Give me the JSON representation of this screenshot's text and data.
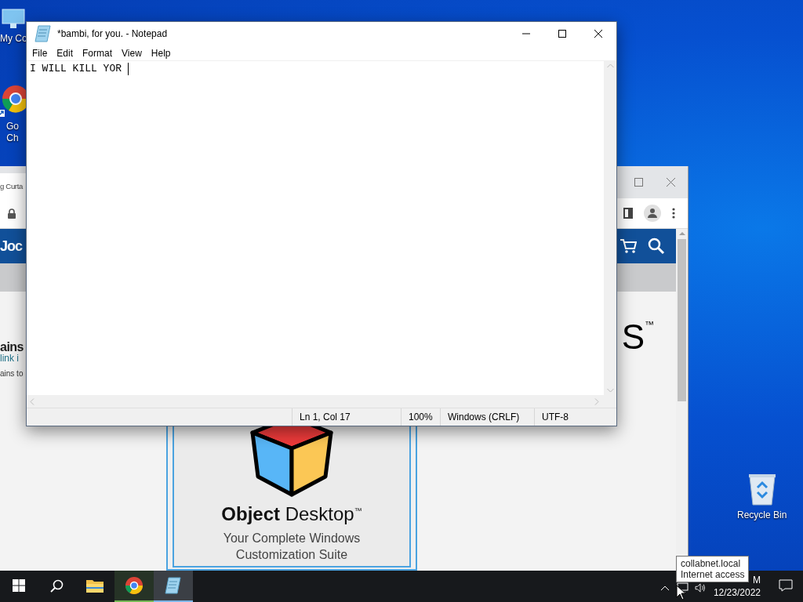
{
  "desktop": {
    "icons": [
      {
        "kind": "computer",
        "lines": [
          "My Co"
        ]
      },
      {
        "kind": "chrome",
        "lines": [
          "Go",
          "Ch"
        ]
      },
      {
        "kind": "recycle",
        "lines": [
          "Recycle Bin"
        ]
      }
    ]
  },
  "browser": {
    "tab_title": "g Curta",
    "logo_text": "Joc",
    "heading_left": "ains",
    "heading_right": "S$^{™}$",
    "paragraph_lines": [
      {
        "text": "link i",
        "kind": "link"
      },
      {
        "text": "ains to",
        "kind": "plain"
      }
    ],
    "ad": {
      "title": "**Object** Desktop$^{™}$",
      "tagline_lines": [
        "Your Complete Windows",
        "Customization Suite"
      ]
    }
  },
  "notepad": {
    "title": "*bambi, for you. - Notepad",
    "menu": [
      "File",
      "Edit",
      "Format",
      "View",
      "Help"
    ],
    "text": "I WILL KILL YOR ",
    "status": [
      "Ln 1, Col 17",
      "100%",
      "Windows (CRLF)",
      "UTF-8"
    ]
  },
  "taskbar": {
    "apps": [
      {
        "kind": "explorer",
        "running": false,
        "selected": false
      },
      {
        "kind": "chrome",
        "running": true,
        "selected": false
      },
      {
        "kind": "notepad",
        "running": true,
        "selected": true
      }
    ],
    "clock_time": "M",
    "clock_date": "12/23/2022"
  },
  "tooltip": {
    "lines": [
      "collabnet.local",
      "Internet access"
    ]
  }
}
